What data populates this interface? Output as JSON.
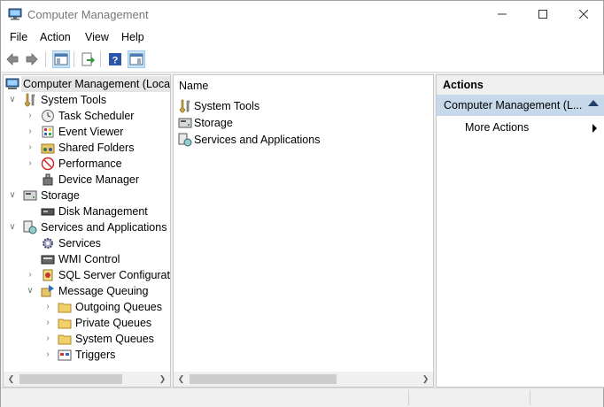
{
  "window": {
    "title": "Computer Management"
  },
  "menu": [
    "File",
    "Action",
    "View",
    "Help"
  ],
  "tree": {
    "root": "Computer Management (Local",
    "items": [
      {
        "label": "System Tools",
        "icon": "tools-icon"
      },
      {
        "label": "Task Scheduler",
        "icon": "clock-icon"
      },
      {
        "label": "Event Viewer",
        "icon": "event-viewer-icon"
      },
      {
        "label": "Shared Folders",
        "icon": "shared-folders-icon"
      },
      {
        "label": "Performance",
        "icon": "performance-icon"
      },
      {
        "label": "Device Manager",
        "icon": "device-manager-icon"
      },
      {
        "label": "Storage",
        "icon": "storage-icon"
      },
      {
        "label": "Disk Management",
        "icon": "disk-icon"
      },
      {
        "label": "Services and Applications",
        "icon": "services-apps-icon"
      },
      {
        "label": "Services",
        "icon": "gear-icon"
      },
      {
        "label": "WMI Control",
        "icon": "wmi-icon"
      },
      {
        "label": "SQL Server Configuratic",
        "icon": "sql-server-icon"
      },
      {
        "label": "Message Queuing",
        "icon": "message-queuing-icon"
      },
      {
        "label": "Outgoing Queues",
        "icon": "folder-icon"
      },
      {
        "label": "Private Queues",
        "icon": "folder-icon"
      },
      {
        "label": "System Queues",
        "icon": "folder-icon"
      },
      {
        "label": "Triggers",
        "icon": "triggers-icon"
      }
    ]
  },
  "list": {
    "header": "Name",
    "items": [
      "System Tools",
      "Storage",
      "Services and Applications"
    ]
  },
  "actions": {
    "header": "Actions",
    "selected": "Computer Management (L...",
    "more": "More Actions"
  }
}
